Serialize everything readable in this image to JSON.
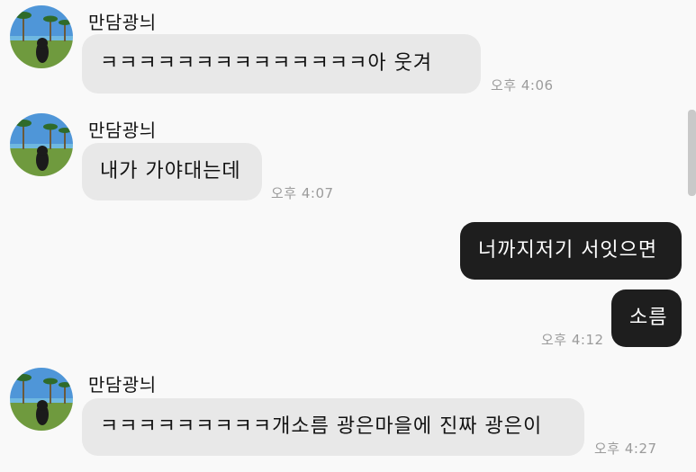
{
  "messages": [
    {
      "sender": "만담광늬",
      "text": "ㅋㅋㅋㅋㅋㅋㅋㅋㅋㅋㅋㅋㅋㅋ아 웃겨",
      "time": "오후 4:06"
    },
    {
      "sender": "만담광늬",
      "text": "내가 가야대는데",
      "time": "오후 4:07"
    },
    {
      "text": "너까지저기 서잇으면"
    },
    {
      "text": "소름",
      "time": "오후 4:12"
    },
    {
      "sender": "만담광늬",
      "text": "ㅋㅋㅋㅋㅋㅋㅋㅋㅋ개소름 광은마을에 진짜 광은이",
      "time": "오후 4:27"
    }
  ],
  "colors": {
    "background": "#f9f9f9",
    "incoming_bubble": "#e8e8e8",
    "outgoing_bubble": "#1e1e1e",
    "timestamp": "#9b9b9b"
  },
  "icons": {
    "profile_picture": "beach-palm-trees-avatar-icon"
  }
}
